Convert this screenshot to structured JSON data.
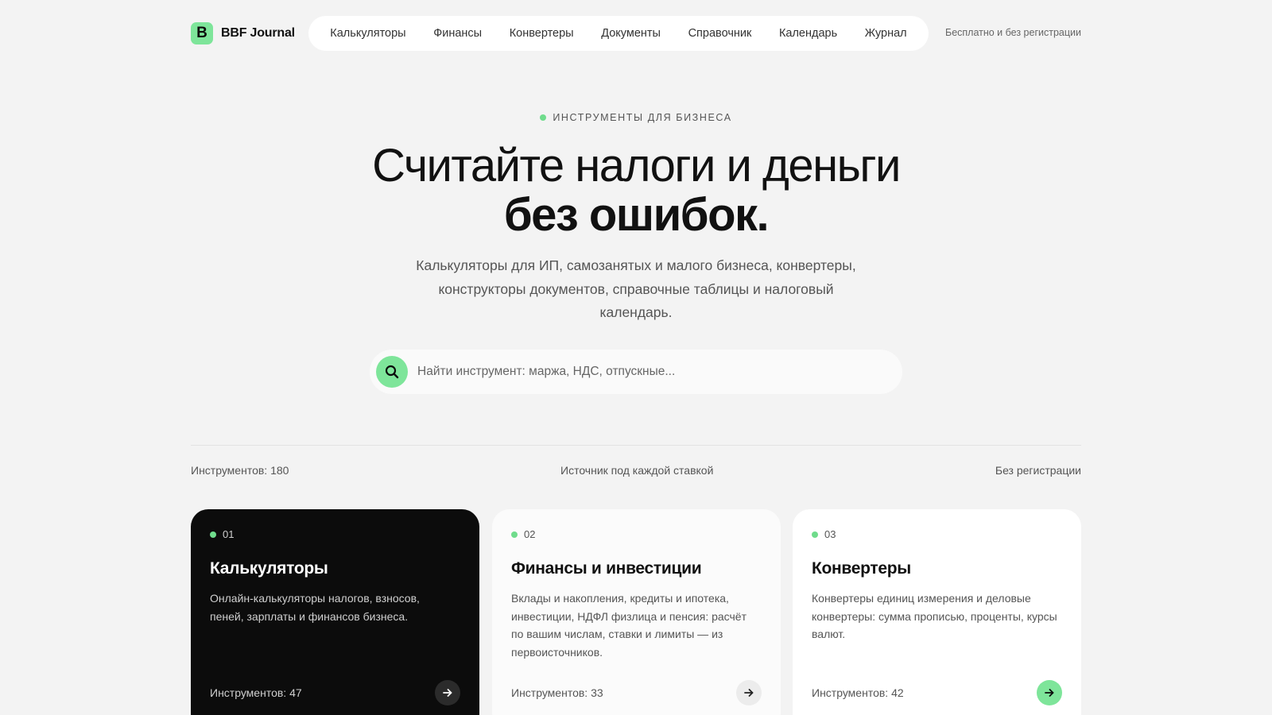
{
  "header": {
    "logo_letter": "B",
    "logo_text": "BBF Journal",
    "nav": [
      {
        "label": "Калькуляторы"
      },
      {
        "label": "Финансы"
      },
      {
        "label": "Конвертеры"
      },
      {
        "label": "Документы"
      },
      {
        "label": "Справочник"
      },
      {
        "label": "Календарь"
      },
      {
        "label": "Журнал"
      }
    ],
    "note": "Бесплатно и без регистрации"
  },
  "hero": {
    "eyebrow": "ИНСТРУМЕНТЫ ДЛЯ БИЗНЕСА",
    "title_line1": "Считайте налоги и деньги",
    "title_line2": "без ошибок.",
    "subtitle": "Калькуляторы для ИП, самозанятых и малого бизнеса, конвертеры, конструкторы документов, справочные таблицы и налоговый календарь."
  },
  "search": {
    "placeholder": "Найти инструмент: маржа, НДС, отпускные..."
  },
  "stats": {
    "tools": "Инструментов: 180",
    "source": "Источник под каждой ставкой",
    "no_reg": "Без регистрации"
  },
  "cards": [
    {
      "num": "01",
      "title": "Калькуляторы",
      "desc": "Онлайн-калькуляторы налогов, взносов, пеней, зарплаты и финансов бизнеса.",
      "count": "Инструментов: 47"
    },
    {
      "num": "02",
      "title": "Финансы и инвестиции",
      "desc": "Вклады и накопления, кредиты и ипотека, инвестиции, НДФЛ физлица и пенсия: расчёт по вашим числам, ставки и лимиты — из первоисточников.",
      "count": "Инструментов: 33"
    },
    {
      "num": "03",
      "title": "Конвертеры",
      "desc": "Конвертеры единиц измерения и деловые конвертеры: сумма прописью, проценты, курсы валют.",
      "count": "Инструментов: 42"
    }
  ],
  "colors": {
    "accent": "#7ee59a",
    "background": "#f3f3f3",
    "dark_card": "#0c0c0c"
  }
}
